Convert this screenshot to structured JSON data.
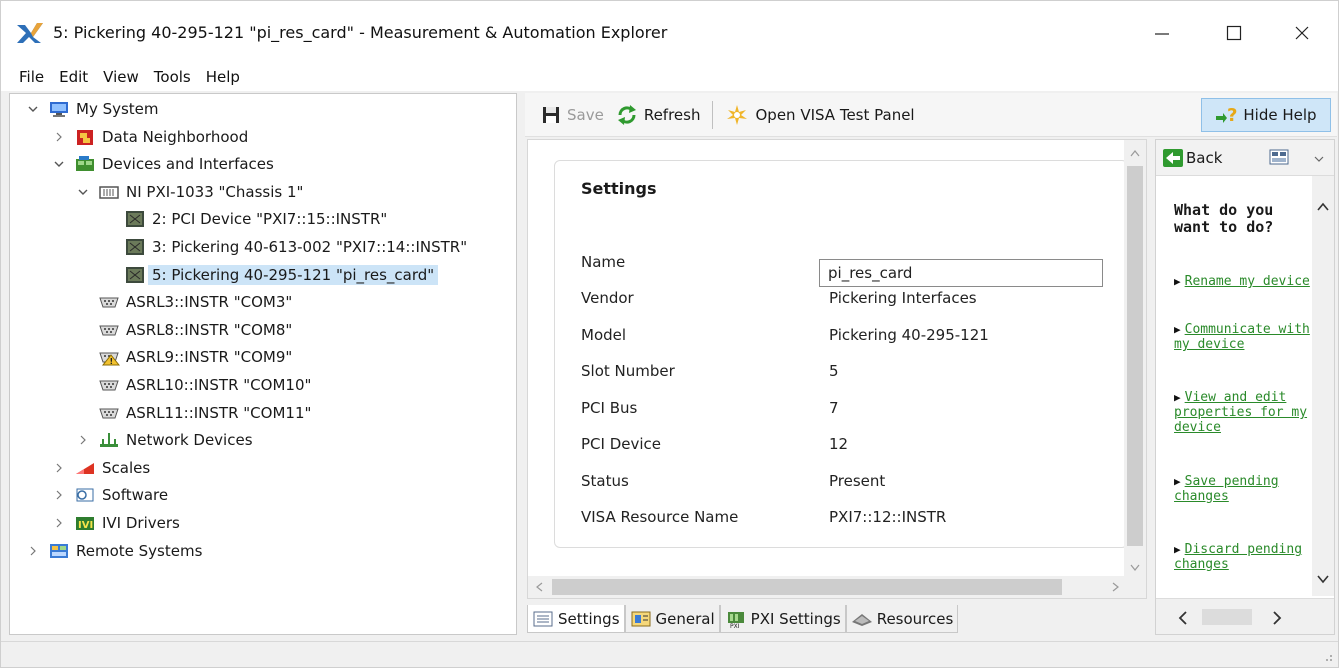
{
  "window": {
    "title": "5: Pickering 40-295-121 \"pi_res_card\" - Measurement & Automation Explorer"
  },
  "menu": [
    "File",
    "Edit",
    "View",
    "Tools",
    "Help"
  ],
  "tree": [
    {
      "label": "My System",
      "level": 0,
      "expander": "open",
      "icon": "computer-icon"
    },
    {
      "label": "Data Neighborhood",
      "level": 1,
      "expander": "closed",
      "icon": "data-neighborhood-icon"
    },
    {
      "label": "Devices and Interfaces",
      "level": 1,
      "expander": "open",
      "icon": "devices-icon"
    },
    {
      "label": "NI PXI-1033 \"Chassis 1\"",
      "level": 2,
      "expander": "open",
      "icon": "chassis-icon"
    },
    {
      "label": "2: PCI Device \"PXI7::15::INSTR\"",
      "level": 3,
      "expander": "none",
      "icon": "card-icon"
    },
    {
      "label": "3: Pickering 40-613-002 \"PXI7::14::INSTR\"",
      "level": 3,
      "expander": "none",
      "icon": "card-icon"
    },
    {
      "label": "5: Pickering 40-295-121 \"pi_res_card\"",
      "level": 3,
      "expander": "none",
      "icon": "card-icon",
      "selected": true
    },
    {
      "label": "ASRL3::INSTR \"COM3\"",
      "level": 2,
      "expander": "none",
      "icon": "serial-port-icon"
    },
    {
      "label": "ASRL8::INSTR \"COM8\"",
      "level": 2,
      "expander": "none",
      "icon": "serial-port-icon"
    },
    {
      "label": "ASRL9::INSTR \"COM9\"",
      "level": 2,
      "expander": "none",
      "icon": "serial-port-warning-icon"
    },
    {
      "label": "ASRL10::INSTR \"COM10\"",
      "level": 2,
      "expander": "none",
      "icon": "serial-port-icon"
    },
    {
      "label": "ASRL11::INSTR \"COM11\"",
      "level": 2,
      "expander": "none",
      "icon": "serial-port-icon"
    },
    {
      "label": "Network Devices",
      "level": 2,
      "expander": "closed",
      "icon": "network-icon"
    },
    {
      "label": "Scales",
      "level": 1,
      "expander": "closed",
      "icon": "scales-icon"
    },
    {
      "label": "Software",
      "level": 1,
      "expander": "closed",
      "icon": "software-icon"
    },
    {
      "label": "IVI Drivers",
      "level": 1,
      "expander": "closed",
      "icon": "ivi-icon"
    },
    {
      "label": "Remote Systems",
      "level": 0,
      "expander": "closed",
      "icon": "remote-icon"
    }
  ],
  "toolbar": {
    "save_label": "Save",
    "refresh_label": "Refresh",
    "visa_label": "Open VISA Test Panel",
    "hide_help_label": "Hide Help"
  },
  "settings": {
    "title": "Settings",
    "name_label": "Name",
    "name_value": "pi_res_card",
    "rows": [
      {
        "label": "Vendor",
        "value": "Pickering Interfaces"
      },
      {
        "label": "Model",
        "value": "Pickering 40-295-121"
      },
      {
        "label": "Slot Number",
        "value": "5"
      },
      {
        "label": "PCI Bus",
        "value": "7"
      },
      {
        "label": "PCI Device",
        "value": "12"
      },
      {
        "label": "Status",
        "value": "Present"
      },
      {
        "label": "VISA Resource Name",
        "value": "PXI7::12::INSTR"
      }
    ]
  },
  "tabs": [
    {
      "label": "Settings",
      "icon": "settings-tab-icon",
      "active": true
    },
    {
      "label": "General",
      "icon": "general-tab-icon"
    },
    {
      "label": "PXI Settings",
      "icon": "pxi-tab-icon"
    },
    {
      "label": "Resources",
      "icon": "resources-tab-icon"
    }
  ],
  "help": {
    "back_label": "Back",
    "heading": "What do you want to do?",
    "links": [
      "Rename my device",
      "Communicate with my device",
      "View and edit properties for my device",
      "Save pending changes",
      "Discard pending changes"
    ]
  },
  "colors": {
    "selection": "#cce4f7",
    "help_link": "#2a8a2a",
    "hide_help_bg": "#cfe6f8"
  }
}
